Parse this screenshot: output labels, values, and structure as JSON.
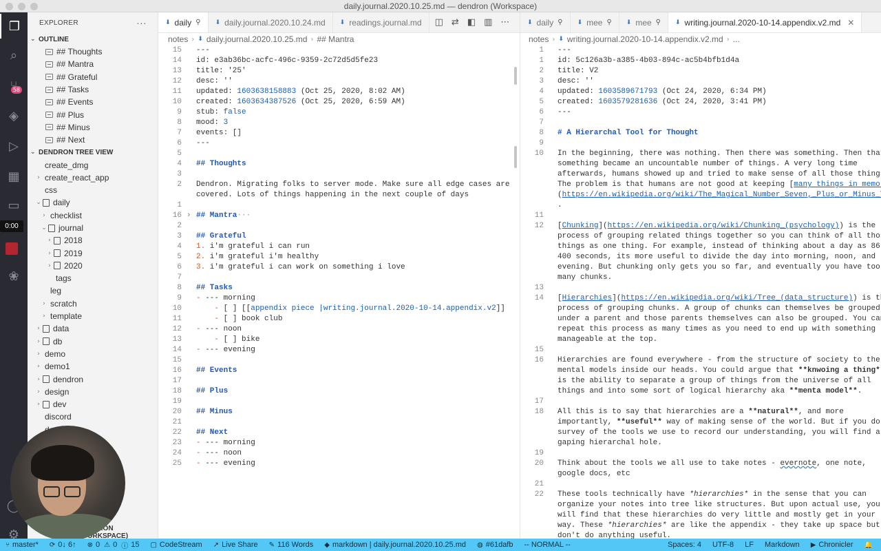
{
  "window": {
    "title": "daily.journal.2020.10.25.md — dendron (Workspace)"
  },
  "activity": {
    "timer": "0:00",
    "badge": "58"
  },
  "sidebar": {
    "title": "EXPLORER",
    "more": "···",
    "outline_title": "OUTLINE",
    "outline": [
      "## Thoughts",
      "## Mantra",
      "## Grateful",
      "## Tasks",
      "## Events",
      "## Plus",
      "## Minus",
      "## Next"
    ],
    "tree_title": "DENDRON TREE VIEW",
    "tree": [
      {
        "label": "create_dmg",
        "indent": 0,
        "tw": "",
        "icon": false
      },
      {
        "label": "create_react_app",
        "indent": 0,
        "tw": "›",
        "icon": false
      },
      {
        "label": "css",
        "indent": 0,
        "tw": "",
        "icon": false
      },
      {
        "label": "daily",
        "indent": 0,
        "tw": "⌄",
        "icon": true
      },
      {
        "label": "checklist",
        "indent": 1,
        "tw": "›",
        "icon": false
      },
      {
        "label": "journal",
        "indent": 1,
        "tw": "⌄",
        "icon": true
      },
      {
        "label": "2018",
        "indent": 2,
        "tw": "›",
        "icon": true
      },
      {
        "label": "2019",
        "indent": 2,
        "tw": "›",
        "icon": true
      },
      {
        "label": "2020",
        "indent": 2,
        "tw": "›",
        "icon": true
      },
      {
        "label": "tags",
        "indent": 2,
        "tw": "",
        "icon": false
      },
      {
        "label": "leg",
        "indent": 1,
        "tw": "",
        "icon": false
      },
      {
        "label": "scratch",
        "indent": 1,
        "tw": "›",
        "icon": false
      },
      {
        "label": "template",
        "indent": 1,
        "tw": "›",
        "icon": false
      },
      {
        "label": "data",
        "indent": 0,
        "tw": "›",
        "icon": true
      },
      {
        "label": "db",
        "indent": 0,
        "tw": "›",
        "icon": true
      },
      {
        "label": "demo",
        "indent": 0,
        "tw": "›",
        "icon": false
      },
      {
        "label": "demo1",
        "indent": 0,
        "tw": "›",
        "icon": false
      },
      {
        "label": "dendron",
        "indent": 0,
        "tw": "›",
        "icon": true
      },
      {
        "label": "design",
        "indent": 0,
        "tw": "›",
        "icon": false
      },
      {
        "label": "dev",
        "indent": 0,
        "tw": "›",
        "icon": true
      },
      {
        "label": "discord",
        "indent": 0,
        "tw": "",
        "icon": false
      },
      {
        "label": "dendron",
        "indent": 0,
        "tw": "",
        "icon": false
      }
    ],
    "workspace_title": "DENDRON (WORKSPACE)"
  },
  "left_editor": {
    "tabs": [
      {
        "label": "daily",
        "active": true,
        "pin": true
      },
      {
        "label": "daily.journal.2020.10.24.md",
        "active": false,
        "pin": false
      },
      {
        "label": "readings.journal.md",
        "active": false,
        "pin": false
      }
    ],
    "breadcrumb": [
      "notes",
      "daily.journal.2020.10.25.md",
      "## Mantra"
    ],
    "lines": [
      {
        "n": "15",
        "html": "---"
      },
      {
        "n": "14",
        "html": "<span class='k'>id:</span> e3ab36bc-acfc-496c-9359-2c72d5d5fe23"
      },
      {
        "n": "13",
        "html": "<span class='k'>title:</span> '25'"
      },
      {
        "n": "12",
        "html": "<span class='k'>desc:</span> ''"
      },
      {
        "n": "11",
        "html": "<span class='k'>updated:</span> <span class='n'>1603638158883</span> (Oct 25, 2020, 8:02 AM)"
      },
      {
        "n": "10",
        "html": "<span class='k'>created:</span> <span class='n'>1603634387526</span> (Oct 25, 2020, 6:59 AM)"
      },
      {
        "n": "9",
        "html": "<span class='k'>stub:</span> <span class='v'>false</span>"
      },
      {
        "n": "8",
        "html": "<span class='k'>mood:</span> <span class='n'>3</span>"
      },
      {
        "n": "7",
        "html": "<span class='k'>events:</span> []"
      },
      {
        "n": "6",
        "html": "---"
      },
      {
        "n": "5",
        "html": ""
      },
      {
        "n": "4",
        "html": "<span class='h'>## Thoughts</span>"
      },
      {
        "n": "3",
        "html": ""
      },
      {
        "n": "2",
        "html": "Dendron. Migrating folks to server mode. Make sure all edge cases are"
      },
      {
        "n": "",
        "html": "covered. Lots of things happening in the next couple of days"
      },
      {
        "n": "1",
        "html": ""
      },
      {
        "n": "16",
        "html": "<span class='h'>## Mantra</span><span style='color:#999'>···</span>"
      },
      {
        "n": "2",
        "html": ""
      },
      {
        "n": "3",
        "html": "<span class='h'>## Grateful</span>"
      },
      {
        "n": "4",
        "html": "<span class='dash'>1.</span> i'm grateful i can run"
      },
      {
        "n": "5",
        "html": "<span class='dash'>2.</span> i'm grateful i'm healthy"
      },
      {
        "n": "6",
        "html": "<span class='dash'>3.</span> i'm grateful i can work on something i love"
      },
      {
        "n": "7",
        "html": ""
      },
      {
        "n": "8",
        "html": "<span class='h'>## Tasks</span>"
      },
      {
        "n": "9",
        "html": "<span class='dash'>-</span> --- morning"
      },
      {
        "n": "10",
        "html": "    <span class='dash'>-</span> [ ] [[<span class='v'>appendix piece |writing.journal.2020-10-14.appendix.v2</span>]]"
      },
      {
        "n": "11",
        "html": "    <span class='dash'>-</span> [ ] book club"
      },
      {
        "n": "12",
        "html": "<span class='dash'>-</span> --- noon"
      },
      {
        "n": "13",
        "html": "    <span class='dash'>-</span> [ ] bike"
      },
      {
        "n": "14",
        "html": "<span class='dash'>-</span> --- evening"
      },
      {
        "n": "15",
        "html": ""
      },
      {
        "n": "16",
        "html": "<span class='h'>## Events</span>"
      },
      {
        "n": "17",
        "html": ""
      },
      {
        "n": "18",
        "html": "<span class='h'>## Plus</span>"
      },
      {
        "n": "19",
        "html": ""
      },
      {
        "n": "20",
        "html": "<span class='h'>## Minus</span>"
      },
      {
        "n": "21",
        "html": ""
      },
      {
        "n": "22",
        "html": "<span class='h'>## Next</span>"
      },
      {
        "n": "23",
        "html": "<span class='dash'>-</span> --- morning"
      },
      {
        "n": "24",
        "html": "<span class='dash'>-</span> --- noon"
      },
      {
        "n": "25",
        "html": "<span class='dash'>-</span> --- evening"
      }
    ]
  },
  "right_editor": {
    "tabs": [
      {
        "label": "daily",
        "active": false,
        "pin": true
      },
      {
        "label": "mee",
        "active": false,
        "pin": true
      },
      {
        "label": "mee",
        "active": false,
        "pin": true
      },
      {
        "label": "writing.journal.2020-10-14.appendix.v2.md",
        "active": true,
        "pin": false
      }
    ],
    "breadcrumb": [
      "notes",
      "writing.journal.2020-10-14.appendix.v2.md",
      "..."
    ],
    "lines": [
      {
        "n": "1",
        "html": "---"
      },
      {
        "n": "1",
        "html": "<span class='k'>id:</span> 5c126a3b-a385-4b03-894c-ac5b4bfb1d4a"
      },
      {
        "n": "2",
        "html": "<span class='k'>title:</span> V2"
      },
      {
        "n": "3",
        "html": "<span class='k'>desc:</span> ''"
      },
      {
        "n": "4",
        "html": "<span class='k'>updated:</span> <span class='n'>1603589671793</span> (Oct 24, 2020, 6:34 PM)"
      },
      {
        "n": "5",
        "html": "<span class='k'>created:</span> <span class='n'>1603579281636</span> (Oct 24, 2020, 3:41 PM)"
      },
      {
        "n": "6",
        "html": "---"
      },
      {
        "n": "7",
        "html": ""
      },
      {
        "n": "8",
        "html": "<span class='h'># A Hierarchal Tool for Thought</span>"
      },
      {
        "n": "9",
        "html": ""
      },
      {
        "n": "10",
        "html": "In the beginning, there was nothing. Then there was something. Then that"
      },
      {
        "n": "",
        "html": "something became an uncountable number of things. A very long time"
      },
      {
        "n": "",
        "html": "afterwards, humans showed up and tried to make sense of all those things."
      },
      {
        "n": "",
        "html": "The problem is that humans are not good at keeping [<span class='lnk'>many things in memory</span>]"
      },
      {
        "n": "",
        "html": "(<span class='lnk'>https://en.wikipedia.org/wiki/The_Magical_Number_Seven,_Plus_or_Minus_Two</span>)"
      },
      {
        "n": "",
        "html": "."
      },
      {
        "n": "11",
        "html": ""
      },
      {
        "n": "12",
        "html": "[<span class='lnk'>Chunking</span>](<span class='lnk'>https://en.wikipedia.org/wiki/Chunking_(psychology)</span>) is the"
      },
      {
        "n": "",
        "html": "process of grouping related things together so you can think of all those"
      },
      {
        "n": "",
        "html": "things as one thing. For example, instead of thinking about a day as 86,"
      },
      {
        "n": "",
        "html": "400 seconds, its more useful to divide the day into morning, noon, and"
      },
      {
        "n": "",
        "html": "evening. But chunking only gets you so far, and eventually you have too"
      },
      {
        "n": "",
        "html": "many chunks."
      },
      {
        "n": "13",
        "html": ""
      },
      {
        "n": "14",
        "html": "[<span class='lnk'>Hierarchies</span>](<span class='lnk'>https://en.wikipedia.org/wiki/Tree_(data_structure)</span>) is the"
      },
      {
        "n": "",
        "html": "process of grouping chunks. A group of chunks can themselves be grouped"
      },
      {
        "n": "",
        "html": "under a parent and those parents themselves can also be grouped. You can"
      },
      {
        "n": "",
        "html": "repeat this process as many times as you need to end up with something"
      },
      {
        "n": "",
        "html": "manageable at the top."
      },
      {
        "n": "15",
        "html": ""
      },
      {
        "n": "16",
        "html": "Hierarchies are found everywhere - from the structure of society to the"
      },
      {
        "n": "",
        "html": "mental models inside our heads. You could argue that <span class='b'>**knwoing a thing**</span>"
      },
      {
        "n": "",
        "html": "is the ability to separate a group of things from the universe of all"
      },
      {
        "n": "",
        "html": "things and into some sort of logical hierarchy aka <span class='b'>**menta model**</span>."
      },
      {
        "n": "17",
        "html": ""
      },
      {
        "n": "18",
        "html": "All this is to say that hierarchies are a <span class='b'>**natural**</span>, and more"
      },
      {
        "n": "",
        "html": "importantly, <span class='b'>**useful**</span> way of making sense of the world. But if you do a"
      },
      {
        "n": "",
        "html": "survey of the tools we use to record our understanding, you will find a"
      },
      {
        "n": "",
        "html": "gaping hierarchal hole."
      },
      {
        "n": "19",
        "html": ""
      },
      {
        "n": "20",
        "html": "Think about the tools we all use to take notes - <span class='sq'>evernote</span>, one note,"
      },
      {
        "n": "",
        "html": "google docs, etc"
      },
      {
        "n": "21",
        "html": ""
      },
      {
        "n": "22",
        "html": "These tools technically have <span class='i'>*hierarchies*</span> in the sense that you can"
      },
      {
        "n": "",
        "html": "organize your notes into tree like structures. But upon actual use, you"
      },
      {
        "n": "",
        "html": "will find that these hierarchies do very little and mostly get in your"
      },
      {
        "n": "",
        "html": "way. These <span class='i'>*hierarchies*</span> are like the appendix - they take up space but"
      },
      {
        "n": "",
        "html": "don't do anything useful."
      }
    ]
  },
  "statusbar": {
    "branch": "master*",
    "sync": "0↓ 6↑",
    "problems": "0",
    "warnings": "0",
    "info": "15",
    "codestream": "CodeStream",
    "liveshare": "Live Share",
    "words": "116 Words",
    "lang_file": "markdown | daily.journal.2020.10.25.md",
    "commit": "#61dafb",
    "mode": "-- NORMAL --",
    "spaces": "Spaces: 4",
    "encoding": "UTF-8",
    "eol": "LF",
    "language": "Markdown",
    "chronicler": "Chronicler"
  }
}
